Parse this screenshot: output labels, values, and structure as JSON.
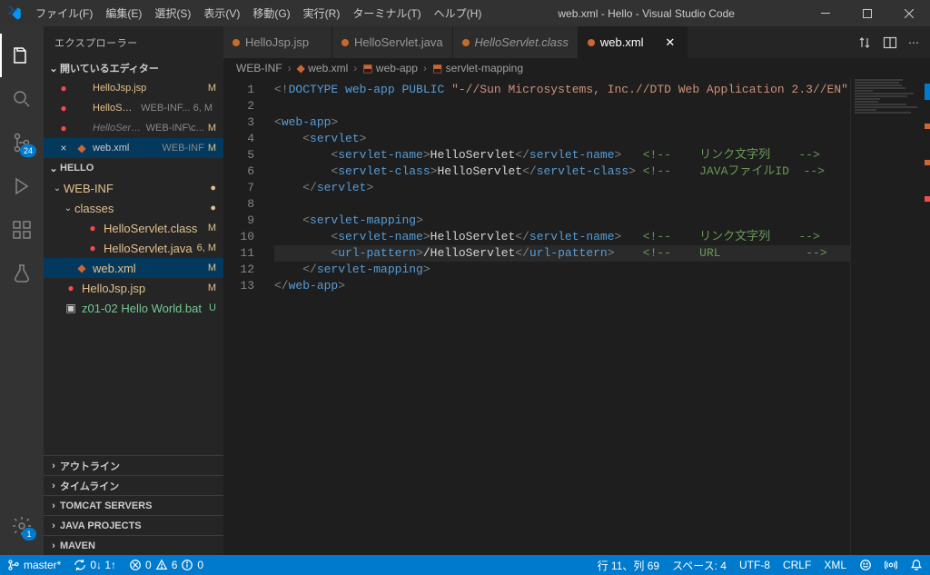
{
  "title": "web.xml - Hello - Visual Studio Code",
  "menus": [
    "ファイル(F)",
    "編集(E)",
    "選択(S)",
    "表示(V)",
    "移動(G)",
    "実行(R)",
    "ターミナル(T)",
    "ヘルプ(H)"
  ],
  "activity_badge_scm": "24",
  "activity_badge_gear": "1",
  "sidebar": {
    "title": "エクスプローラー",
    "open_editors_label": "開いているエディター",
    "project_label": "HELLO",
    "open_editors": [
      {
        "icon": "●",
        "iconcls": "red-dot",
        "name": "HelloJsp.jsp",
        "meta": "",
        "badge": "M",
        "mod": true
      },
      {
        "icon": "●",
        "iconcls": "red-dot",
        "name": "HelloServlet.java",
        "meta": "WEB-INF... 6, M",
        "badge": "",
        "mod": true
      },
      {
        "icon": "●",
        "iconcls": "red-dot",
        "name": "HelloServlet.class",
        "meta": "WEB-INF\\c...",
        "badge": "M",
        "dim": true
      },
      {
        "icon": "×",
        "iconcls": "",
        "name": "web.xml",
        "meta": "WEB-INF",
        "badge": "M",
        "sel": true,
        "orange": true
      }
    ],
    "tree": [
      {
        "type": "folder",
        "indent": 0,
        "chev": "⌄",
        "name": "WEB-INF",
        "mod": true,
        "bullet": "●"
      },
      {
        "type": "folder",
        "indent": 1,
        "chev": "⌄",
        "name": "classes",
        "mod": true,
        "bullet": "●"
      },
      {
        "type": "file",
        "indent": 2,
        "icon": "●",
        "iconcls": "red-dot",
        "name": "HelloServlet.class",
        "badge": "M",
        "mod": true
      },
      {
        "type": "file",
        "indent": 2,
        "icon": "●",
        "iconcls": "red-dot",
        "name": "HelloServlet.java",
        "badge": "6, M",
        "mod": true
      },
      {
        "type": "file",
        "indent": 1,
        "icon": "◆",
        "iconcls": "orange-file",
        "name": "web.xml",
        "badge": "M",
        "mod": true,
        "sel": true
      },
      {
        "type": "file",
        "indent": 0,
        "icon": "●",
        "iconcls": "red-dot",
        "name": "HelloJsp.jsp",
        "badge": "M",
        "mod": true
      },
      {
        "type": "file",
        "indent": 0,
        "icon": "▣",
        "iconcls": "",
        "name": "z01-02 Hello World.bat",
        "badge": "U",
        "untracked": true
      }
    ],
    "collapsed": [
      "アウトライン",
      "タイムライン",
      "TOMCAT SERVERS",
      "JAVA PROJECTS",
      "MAVEN"
    ]
  },
  "tabs": [
    {
      "name": "HelloJsp.jsp",
      "color": "#c76b29",
      "active": false
    },
    {
      "name": "HelloServlet.java",
      "color": "#c76b29",
      "active": false
    },
    {
      "name": "HelloServlet.class",
      "color": "#c76b29",
      "active": false,
      "italic": true
    },
    {
      "name": "web.xml",
      "color": "#cc6633",
      "active": true
    }
  ],
  "breadcrumbs": [
    "WEB-INF",
    "web.xml",
    "web-app",
    "servlet-mapping"
  ],
  "gutter_max": 13,
  "code_lines": [
    {
      "n": 1,
      "html": "<span class='gr'>&lt;!</span><span class='bl'>DOCTYPE</span> <span class='bl'>web-app</span> <span class='bl'>PUBLIC</span> <span class='st'>\"-//Sun Microsystems, Inc.//DTD Web Application 2.3//EN\"</span> <span class='st'>\"http://java.su</span>"
    },
    {
      "n": 2,
      "html": ""
    },
    {
      "n": 3,
      "html": "<span class='gr'>&lt;</span><span class='bl'>web-app</span><span class='gr'>&gt;</span>"
    },
    {
      "n": 4,
      "html": "    <span class='gr'>&lt;</span><span class='bl'>servlet</span><span class='gr'>&gt;</span>"
    },
    {
      "n": 5,
      "html": "        <span class='gr'>&lt;</span><span class='bl'>servlet-name</span><span class='gr'>&gt;</span><span class='tx'>HelloServlet</span><span class='gr'>&lt;/</span><span class='bl'>servlet-name</span><span class='gr'>&gt;</span>   <span class='cm'>&lt;!--    リンク文字列    --&gt;</span>"
    },
    {
      "n": 6,
      "html": "        <span class='gr'>&lt;</span><span class='bl'>servlet-class</span><span class='gr'>&gt;</span><span class='tx'>HelloServlet</span><span class='gr'>&lt;/</span><span class='bl'>servlet-class</span><span class='gr'>&gt;</span> <span class='cm'>&lt;!--    JAVAファイルID  --&gt;</span>"
    },
    {
      "n": 7,
      "html": "    <span class='gr'>&lt;/</span><span class='bl'>servlet</span><span class='gr'>&gt;</span>"
    },
    {
      "n": 8,
      "html": ""
    },
    {
      "n": 9,
      "html": "    <span class='gr'>&lt;</span><span class='bl'>servlet-mapping</span><span class='gr'>&gt;</span>"
    },
    {
      "n": 10,
      "html": "        <span class='gr'>&lt;</span><span class='bl'>servlet-name</span><span class='gr'>&gt;</span><span class='tx'>HelloServlet</span><span class='gr'>&lt;/</span><span class='bl'>servlet-name</span><span class='gr'>&gt;</span>   <span class='cm'>&lt;!--    リンク文字列    --&gt;</span>"
    },
    {
      "n": 11,
      "html": "        <span class='gr'>&lt;</span><span class='bl'>url-pattern</span><span class='gr'>&gt;</span><span class='tx'>/HelloServlet</span><span class='gr'>&lt;/</span><span class='bl'>url-pattern</span><span class='gr'>&gt;</span>    <span class='cm'>&lt;!--    URL            --&gt;</span>",
      "hl": true
    },
    {
      "n": 12,
      "html": "    <span class='gr'>&lt;/</span><span class='bl'>servlet-mapping</span><span class='gr'>&gt;</span>"
    },
    {
      "n": 13,
      "html": "<span class='gr'>&lt;/</span><span class='bl'>web-app</span><span class='gr'>&gt;</span>"
    }
  ],
  "status": {
    "branch": "master*",
    "sync": "0↓ 1↑",
    "errors": "0",
    "warnings": "6",
    "info": "0",
    "cursor": "行 11、列 69",
    "spaces": "スペース: 4",
    "encoding": "UTF-8",
    "eol": "CRLF",
    "language": "XML"
  }
}
